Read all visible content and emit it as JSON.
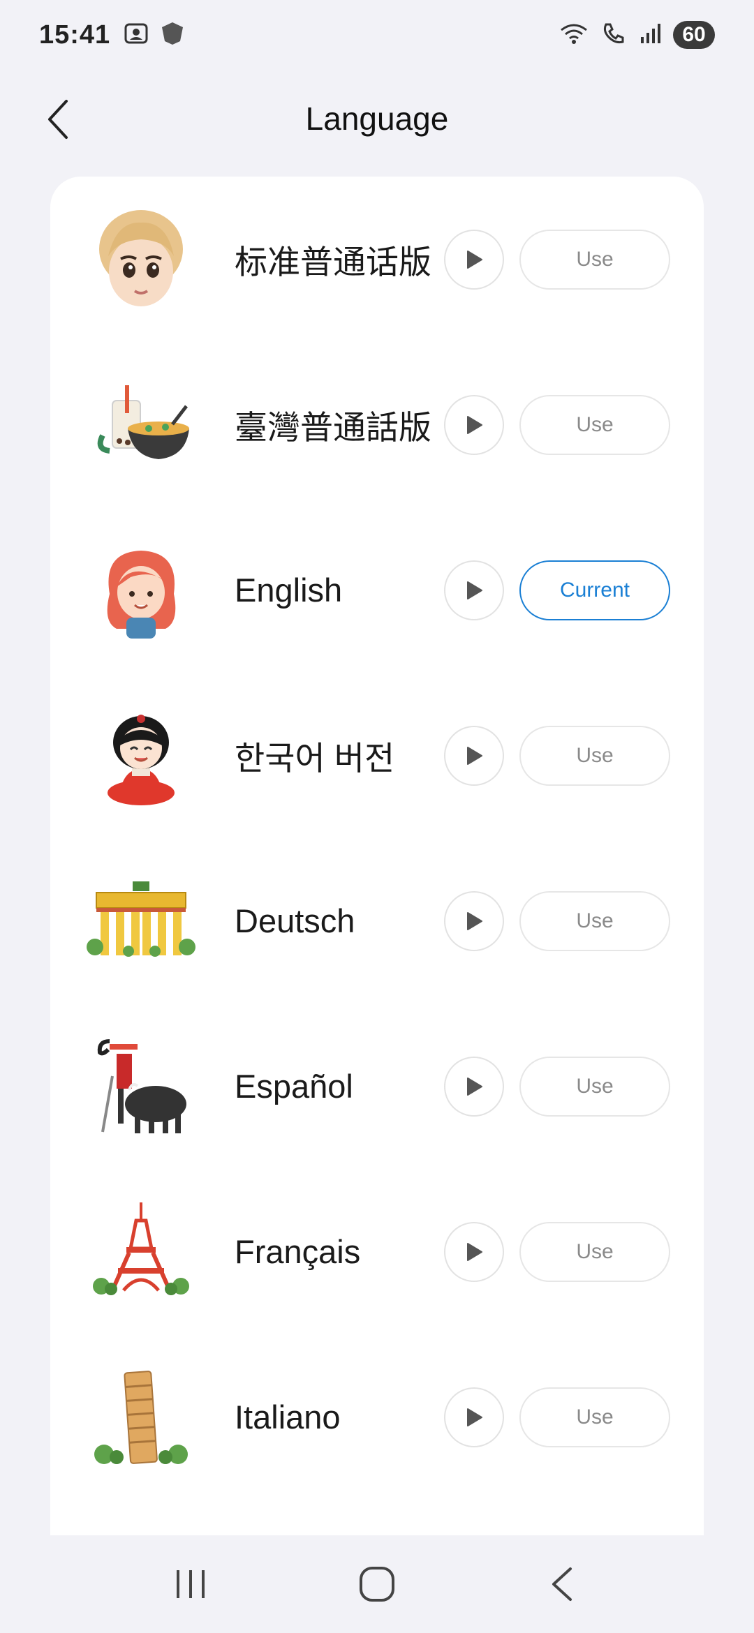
{
  "status_bar": {
    "time": "15:41",
    "battery": "60",
    "icons": [
      "screenshot-icon",
      "shield-icon",
      "wifi-icon",
      "wifi-call-icon",
      "signal-icon",
      "battery-icon"
    ]
  },
  "header": {
    "title": "Language",
    "back_icon": "chevron-left-icon"
  },
  "languages": [
    {
      "name": "标准普通话版",
      "button": "Use",
      "avatar": "blonde-girl-avatar"
    },
    {
      "name": "臺灣普通話版",
      "button": "Use",
      "avatar": "bubble-tea-noodles-avatar"
    },
    {
      "name": "English",
      "button": "Current",
      "avatar": "red-hair-girl-avatar"
    },
    {
      "name": "한국어 버전",
      "button": "Use",
      "avatar": "hanbok-girl-avatar"
    },
    {
      "name": "Deutsch",
      "button": "Use",
      "avatar": "brandenburg-gate-avatar"
    },
    {
      "name": "Español",
      "button": "Use",
      "avatar": "matador-bull-avatar"
    },
    {
      "name": "Français",
      "button": "Use",
      "avatar": "eiffel-tower-avatar"
    },
    {
      "name": "Italiano",
      "button": "Use",
      "avatar": "leaning-tower-avatar"
    }
  ],
  "colors": {
    "background": "#f2f2f7",
    "accent": "#1a7fd4",
    "card": "#ffffff"
  },
  "nav_bar": {
    "icons": [
      "recents-icon",
      "home-icon",
      "back-icon"
    ]
  }
}
